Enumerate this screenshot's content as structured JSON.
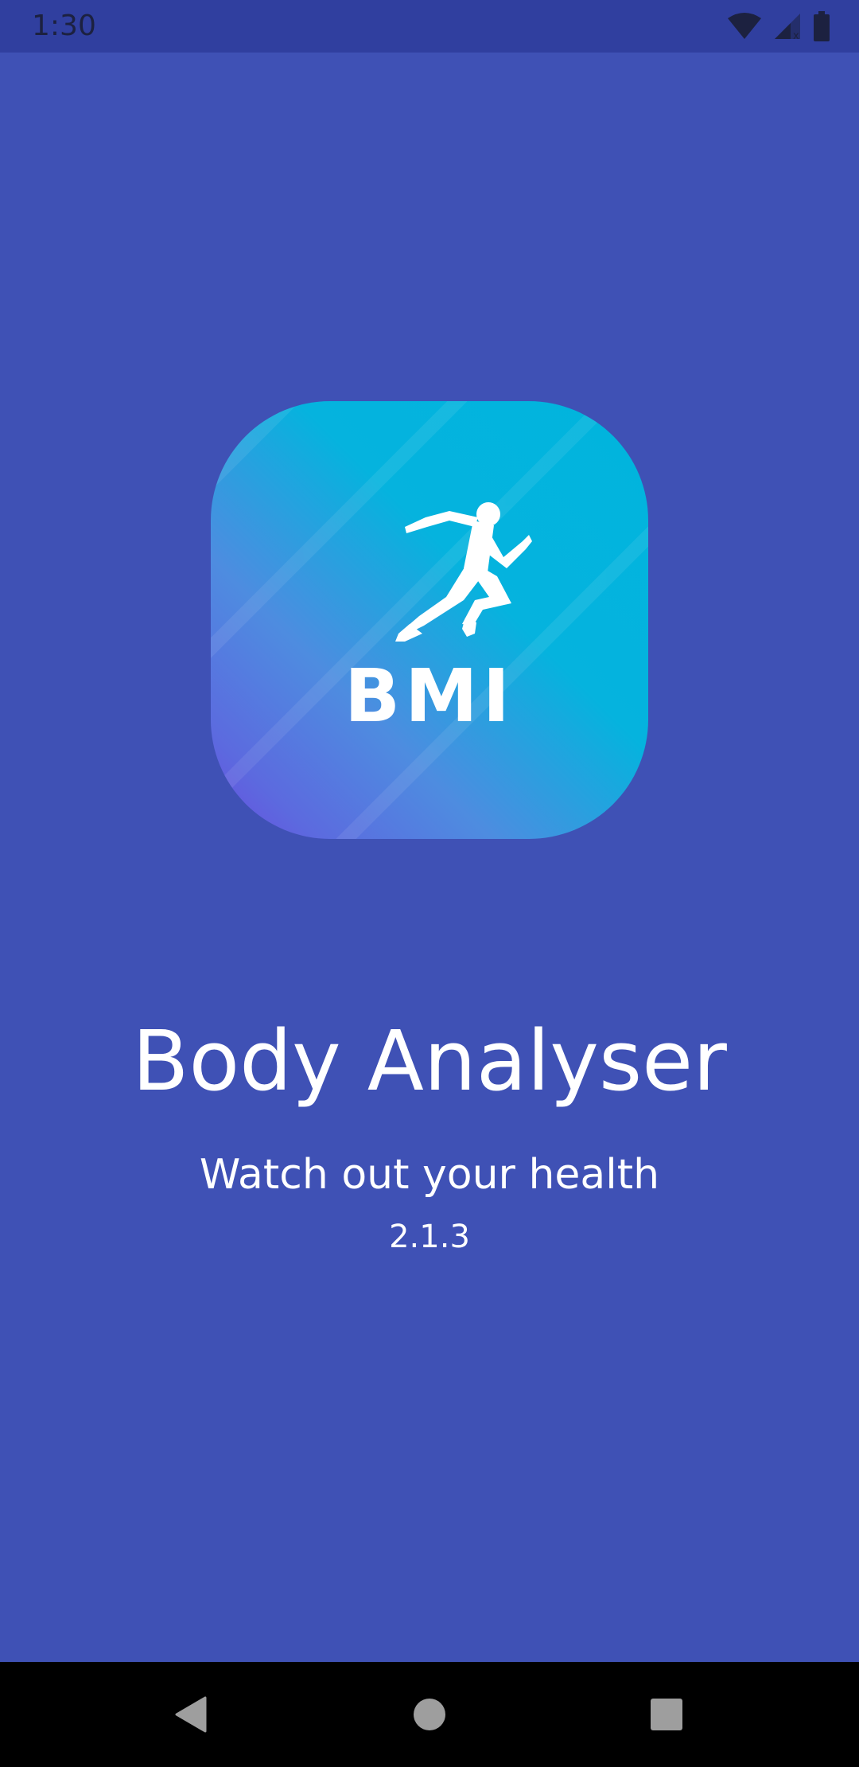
{
  "status_bar": {
    "time": "1:30",
    "icons": [
      "wifi-icon",
      "cell-signal-icon",
      "battery-icon"
    ]
  },
  "app_icon": {
    "logo_text": "BMI",
    "glyph": "running-man-icon",
    "colors": {
      "gradient_start": "#00B4DD",
      "gradient_end": "#6A4BDE"
    }
  },
  "splash": {
    "title": "Body Analyser",
    "subtitle": "Watch out your health",
    "version": "2.1.3"
  },
  "nav_bar": {
    "buttons": [
      "back-icon",
      "home-icon",
      "recents-icon"
    ]
  },
  "colors": {
    "background": "#3F51B5",
    "status_bar": "#303F9F",
    "nav_bar": "#000000",
    "text": "#FFFFFF"
  }
}
